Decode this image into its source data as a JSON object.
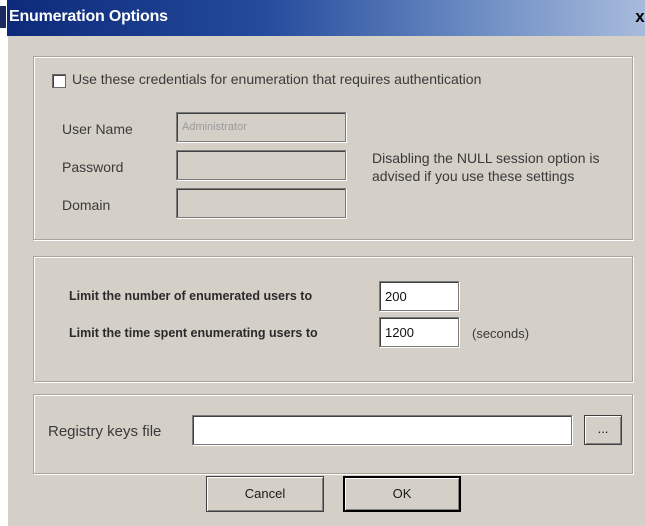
{
  "window": {
    "title": "Enumeration Options",
    "close_glyph": "x"
  },
  "credentials": {
    "checkbox_label": "Use these credentials for enumeration that requires authentication",
    "checked": false,
    "username_label": "User Name",
    "username_value": "Administrator",
    "password_label": "Password",
    "password_value": "",
    "domain_label": "Domain",
    "domain_value": "",
    "hint_line1": "Disabling the NULL session option is",
    "hint_line2": "advised if you use these settings"
  },
  "limits": {
    "users_label": "Limit the number of enumerated users to",
    "users_value": "200",
    "time_label": "Limit the time spent enumerating users to",
    "time_value": "1200",
    "time_unit": "(seconds)"
  },
  "registry": {
    "label": "Registry keys file",
    "value": "",
    "browse_label": "..."
  },
  "buttons": {
    "cancel": "Cancel",
    "ok": "OK"
  }
}
